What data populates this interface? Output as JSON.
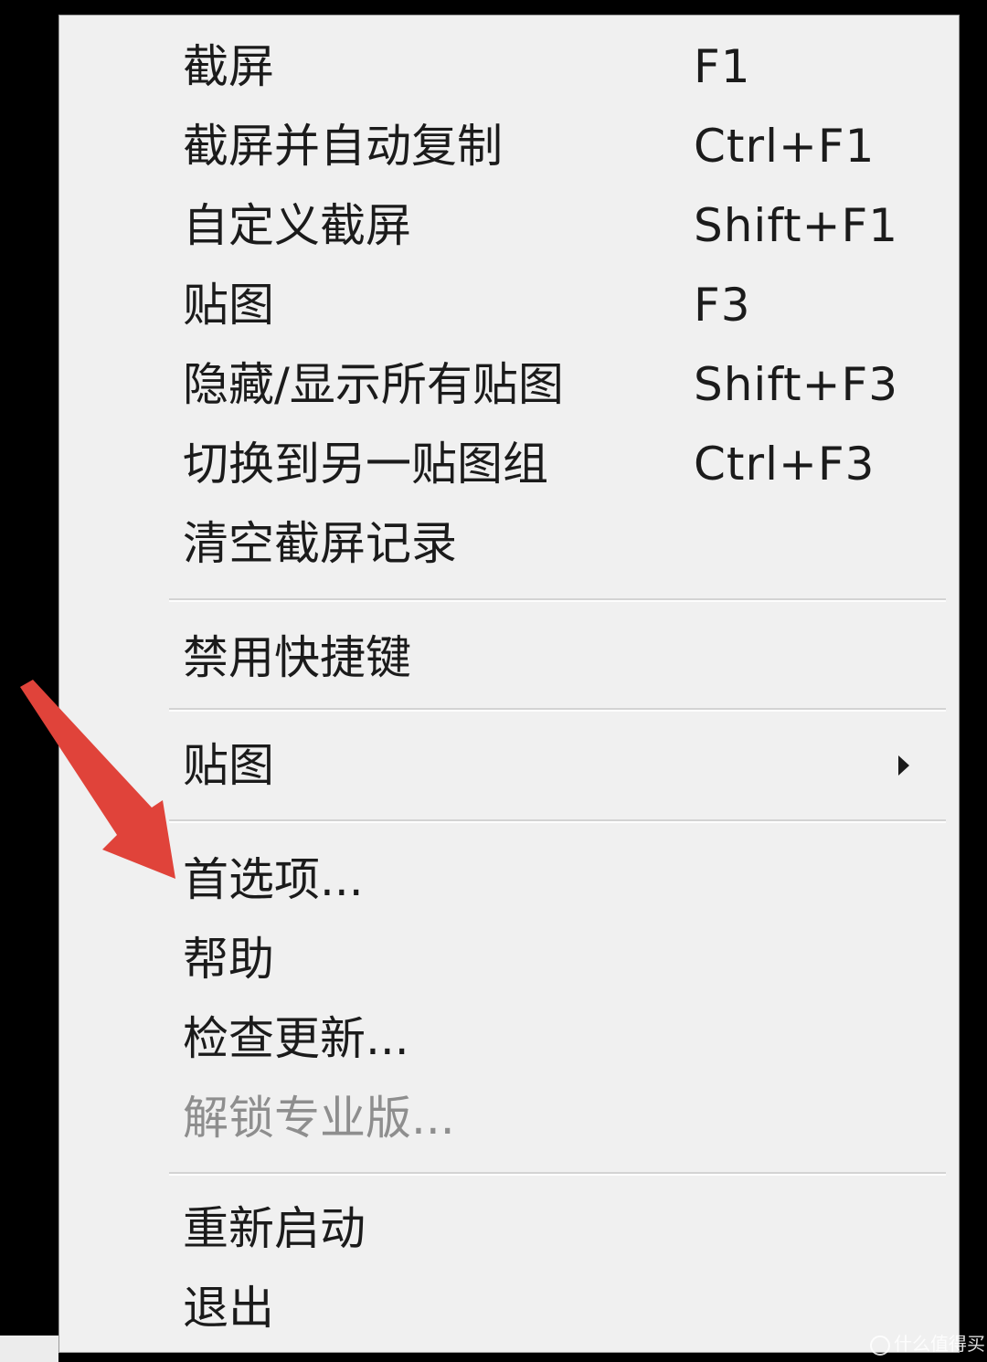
{
  "menu": {
    "items": [
      {
        "label": "截屏",
        "shortcut": "F1"
      },
      {
        "label": "截屏并自动复制",
        "shortcut": "Ctrl+F1"
      },
      {
        "label": "自定义截屏",
        "shortcut": "Shift+F1"
      },
      {
        "label": "贴图",
        "shortcut": "F3"
      },
      {
        "label": "隐藏/显示所有贴图",
        "shortcut": "Shift+F3"
      },
      {
        "label": "切换到另一贴图组",
        "shortcut": "Ctrl+F3"
      },
      {
        "label": "清空截屏记录"
      },
      {
        "label": "禁用快捷键"
      },
      {
        "label": "贴图"
      },
      {
        "label": "首选项..."
      },
      {
        "label": "帮助"
      },
      {
        "label": "检查更新..."
      },
      {
        "label": "解锁专业版..."
      },
      {
        "label": "重新启动"
      },
      {
        "label": "退出"
      }
    ]
  },
  "watermark": {
    "text": "什么值得买"
  },
  "colors": {
    "menu_background": "#f0f0f0",
    "menu_text": "#1b1b1b",
    "disabled_text": "#8e8e8e",
    "annotation_arrow": "#e0433a"
  }
}
